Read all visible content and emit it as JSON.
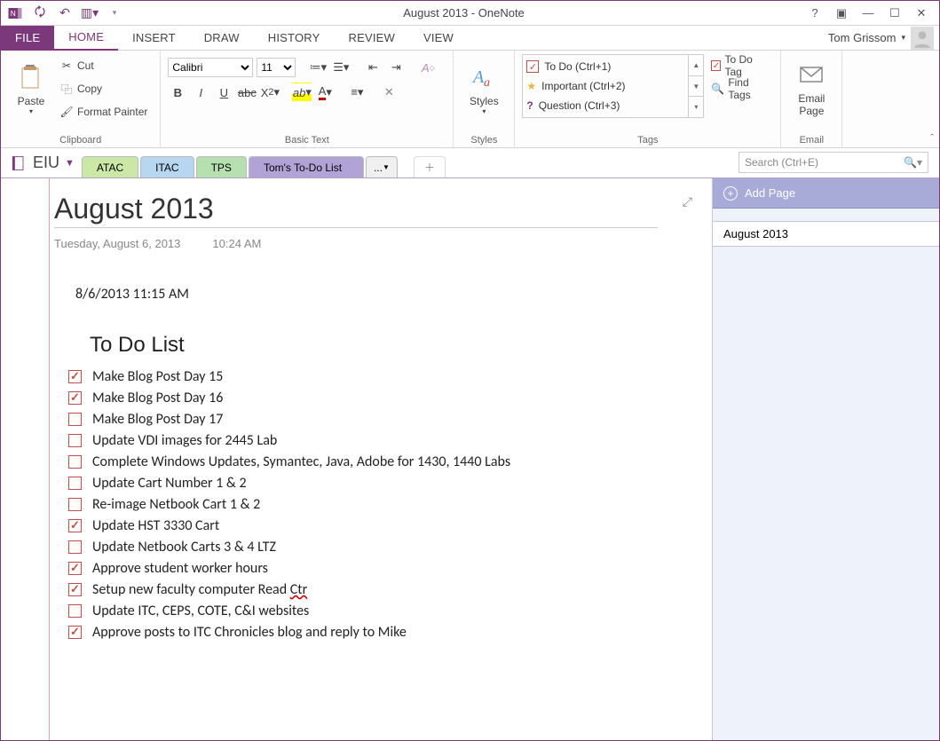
{
  "window": {
    "title": "August 2013 - OneNote"
  },
  "user": {
    "name": "Tom Grissom"
  },
  "ribbonTabs": [
    "FILE",
    "HOME",
    "INSERT",
    "DRAW",
    "HISTORY",
    "REVIEW",
    "VIEW"
  ],
  "clipboard": {
    "paste": "Paste",
    "cut": "Cut",
    "copy": "Copy",
    "formatPainter": "Format Painter",
    "label": "Clipboard"
  },
  "basicText": {
    "font": "Calibri",
    "size": "11",
    "label": "Basic Text"
  },
  "styles": {
    "btn": "Styles",
    "label": "Styles"
  },
  "tags": {
    "items": [
      "To Do (Ctrl+1)",
      "Important (Ctrl+2)",
      "Question (Ctrl+3)"
    ],
    "todoTag": "To Do Tag",
    "findTags": "Find Tags",
    "label": "Tags"
  },
  "email": {
    "btn1": "Email",
    "btn2": "Page",
    "label": "Email"
  },
  "notebook": "EIU",
  "sections": [
    "ATAC",
    "ITAC",
    "TPS",
    "Tom's To-Do List"
  ],
  "sectionsMore": "...",
  "search": {
    "placeholder": "Search (Ctrl+E)"
  },
  "addPage": "Add Page",
  "pageList": [
    "August 2013"
  ],
  "page": {
    "title": "August 2013",
    "date": "Tuesday, August 6, 2013",
    "time": "10:24 AM",
    "timestamp": "8/6/2013 11:15 AM",
    "listTitle": "To Do List",
    "todos": [
      {
        "checked": true,
        "text": "Make Blog Post Day 15"
      },
      {
        "checked": true,
        "text": "Make Blog Post Day 16"
      },
      {
        "checked": false,
        "text": "Make Blog Post Day 17"
      },
      {
        "checked": false,
        "text": "Update VDI images for 2445 Lab"
      },
      {
        "checked": false,
        "text": "Complete Windows Updates, Symantec, Java, Adobe for 1430, 1440 Labs"
      },
      {
        "checked": false,
        "text": "Update Cart Number 1 & 2"
      },
      {
        "checked": false,
        "text": "Re-image Netbook Cart 1 & 2"
      },
      {
        "checked": true,
        "text": "Update HST 3330 Cart"
      },
      {
        "checked": false,
        "text": "Update Netbook Carts 3 & 4 LTZ"
      },
      {
        "checked": true,
        "text": "Approve student worker hours"
      },
      {
        "checked": true,
        "text": "Setup new faculty computer Read ",
        "misspell": "Ctr"
      },
      {
        "checked": false,
        "text": "Update ITC, CEPS, COTE, C&I websites"
      },
      {
        "checked": true,
        "text": "Approve posts to ITC Chronicles blog and reply to Mike"
      }
    ]
  }
}
